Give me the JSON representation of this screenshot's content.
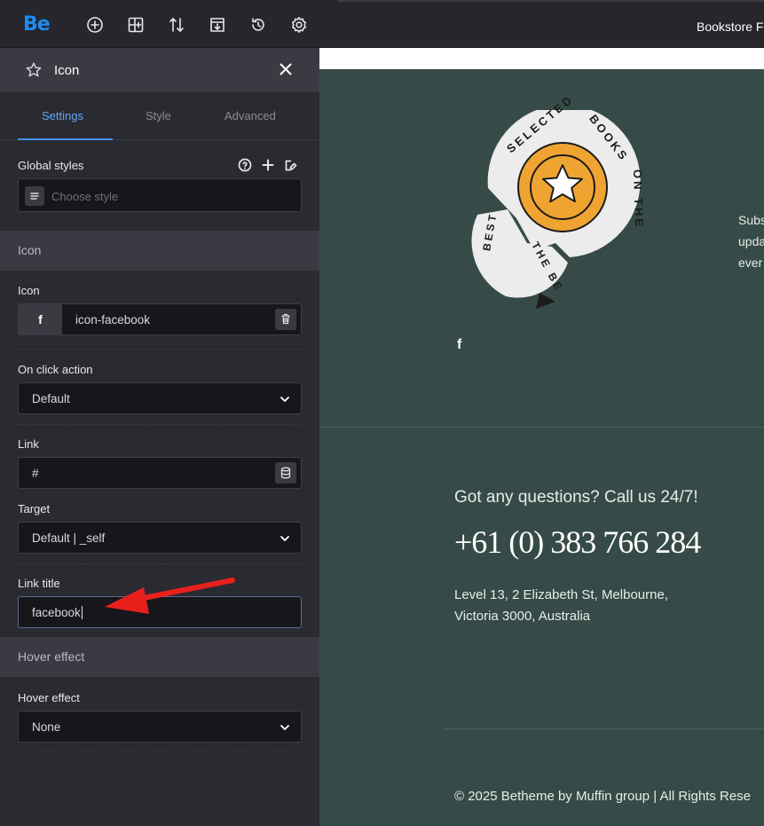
{
  "toolbar": {
    "logo": "Be",
    "icons": [
      "add-icon",
      "layout-icon",
      "sort-icon",
      "export-icon",
      "history-icon",
      "settings-icon"
    ],
    "site_title": "Bookstore F"
  },
  "panel": {
    "header_title": "Icon",
    "tabs": [
      {
        "label": "Settings",
        "active": true
      },
      {
        "label": "Style",
        "active": false
      },
      {
        "label": "Advanced",
        "active": false
      }
    ],
    "global_styles": {
      "label": "Global styles",
      "placeholder": "Choose style"
    },
    "sections": {
      "icon": "Icon",
      "hover": "Hover effect"
    },
    "icon_field": {
      "label": "Icon",
      "value": "icon-facebook",
      "preview_glyph": "f"
    },
    "on_click": {
      "label": "On click action",
      "value": "Default"
    },
    "link": {
      "label": "Link",
      "value": "#"
    },
    "target": {
      "label": "Target",
      "value": "Default | _self"
    },
    "link_title": {
      "label": "Link title",
      "value": "facebook"
    },
    "hover_effect": {
      "label": "Hover effect",
      "value": "None"
    }
  },
  "preview": {
    "badge_text": "SELECTED BOOKS ON THE BESTHE BEST",
    "badge_colors": {
      "paper": "#ececec",
      "accent": "#efa431",
      "ink": "#1c1c1c"
    },
    "subscribe_lines": [
      "Subs",
      "upda",
      "ever"
    ],
    "social_glyph": "f",
    "question": "Got any questions? Call us 24/7!",
    "phone": "+61 (0) 383 766 284",
    "address_line1": "Level 13, 2 Elizabeth St, Melbourne,",
    "address_line2": "Victoria 3000, Australia",
    "copyright": "© 2025 Betheme by Muffin group | All Rights Rese"
  },
  "colors": {
    "accent_blue": "#1e8cf0",
    "active_tab": "#5fa9f5",
    "preview_bg": "#364b47",
    "annotation_arrow": "#e8201c"
  }
}
